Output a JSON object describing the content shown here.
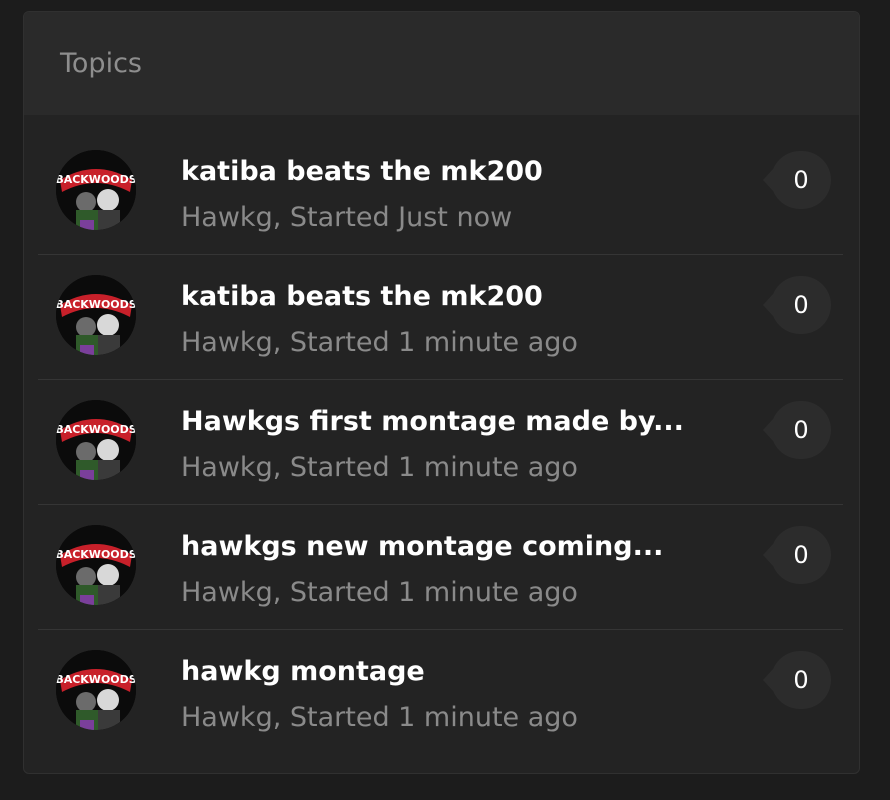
{
  "panel": {
    "title": "Topics"
  },
  "topics": [
    {
      "title": "katiba beats the mk200",
      "meta": "Hawkg, Started Just now",
      "replies": "0",
      "avatar_text": "BACKWOODS"
    },
    {
      "title": "katiba beats the mk200",
      "meta": "Hawkg, Started 1 minute ago",
      "replies": "0",
      "avatar_text": "BACKWOODS"
    },
    {
      "title": "Hawkgs first montage made by...",
      "meta": "Hawkg, Started 1 minute ago",
      "replies": "0",
      "avatar_text": "BACKWOODS"
    },
    {
      "title": "hawkgs new montage coming...",
      "meta": "Hawkg, Started 1 minute ago",
      "replies": "0",
      "avatar_text": "BACKWOODS"
    },
    {
      "title": "hawkg montage",
      "meta": "Hawkg, Started 1 minute ago",
      "replies": "0",
      "avatar_text": "BACKWOODS"
    }
  ],
  "colors": {
    "background": "#1c1c1c",
    "panel": "#232323",
    "header": "#2a2a2a",
    "title_text": "#ffffff",
    "meta_text": "#8a8a8a",
    "badge": "#2c2c2c",
    "avatar_logo": "#c8202a"
  }
}
